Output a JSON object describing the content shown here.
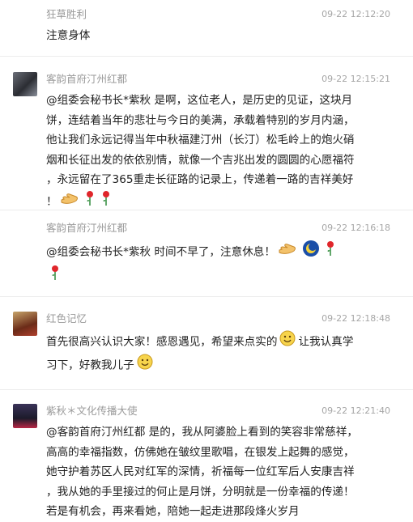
{
  "comments": [
    {
      "name": "狂草胜利",
      "time": "09-22 12:12:20",
      "lines": [
        "注意身体"
      ]
    },
    {
      "name": "客韵首府汀州红都",
      "time": "09-22 12:15:21",
      "lines": [
        "@组委会秘书长*紫秋 是啊，这位老人，是历史的见证，这块月",
        "饼，连结着当年的悲壮与今日的美满，承载着特别的岁月内涵，",
        "他让我们永远记得当年中秋福建汀州（长汀）松毛岭上的炮火硝",
        "烟和长征出发的依依别情，就像一个吉兆出发的圆圆的心愿福符",
        "，永远留在了365重走长征路的记录上，传递着一路的吉祥美好",
        "！"
      ]
    },
    {
      "name": "客韵首府汀州红都",
      "time": "09-22 12:16:18",
      "lines": [
        "@组委会秘书长*紫秋 时间不早了，注意休息！"
      ]
    },
    {
      "name": "红色记忆",
      "time": "09-22 12:18:48",
      "lines": [
        "首先很高兴认识大家！感恩遇见，希望来点实的",
        "让我认真学",
        "习下，好教我儿子"
      ]
    },
    {
      "name": "紫秋＊文化传播大使",
      "time": "09-22 12:21:40",
      "lines": [
        "@客韵首府汀州红都 是的，我从阿婆脸上看到的笑容非常慈祥，",
        "高高的幸福指数，仿佛她在皱纹里歌唱，在银发上起舞的感觉，",
        "她守护着苏区人民对红军的深情，祈福每一位红军后人安康吉祥",
        "，我从她的手里接过的何止是月饼，分明就是一份幸福的传递！",
        "若是有机会，再来看她，陪她一起走进那段烽火岁月"
      ]
    }
  ],
  "icons": [
    "rose-icon",
    "fist-bump-icon",
    "smile-icon",
    "moon-icon"
  ]
}
